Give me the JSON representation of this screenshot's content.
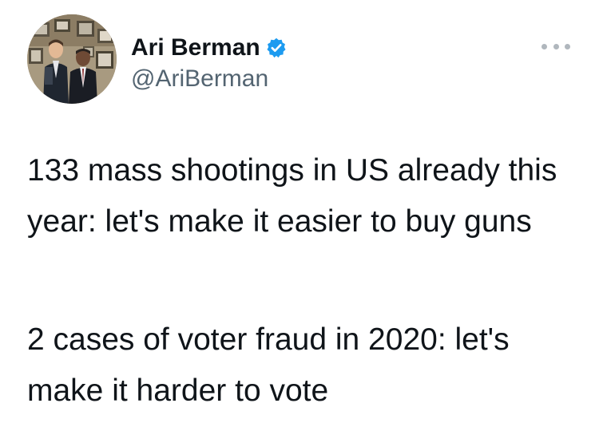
{
  "author": {
    "display_name": "Ari Berman",
    "handle": "@AriBerman",
    "verified": true,
    "verified_color": "#1d9bf0"
  },
  "tweet": {
    "paragraphs": [
      "133 mass shootings in US already this year: let's make it easier to buy guns",
      "2 cases of voter fraud in 2020: let's make it harder to vote"
    ]
  },
  "icons": {
    "verified": "verified-badge-icon",
    "more": "more-options-icon"
  }
}
